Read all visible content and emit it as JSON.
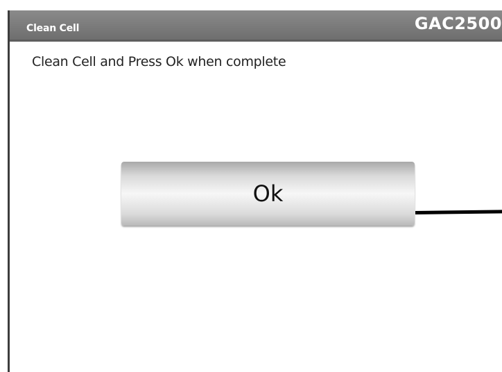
{
  "dialog": {
    "title": "Clean Cell",
    "instrument": "GAC2500",
    "message": "Clean Cell and Press Ok when complete",
    "ok_label": "Ok"
  }
}
